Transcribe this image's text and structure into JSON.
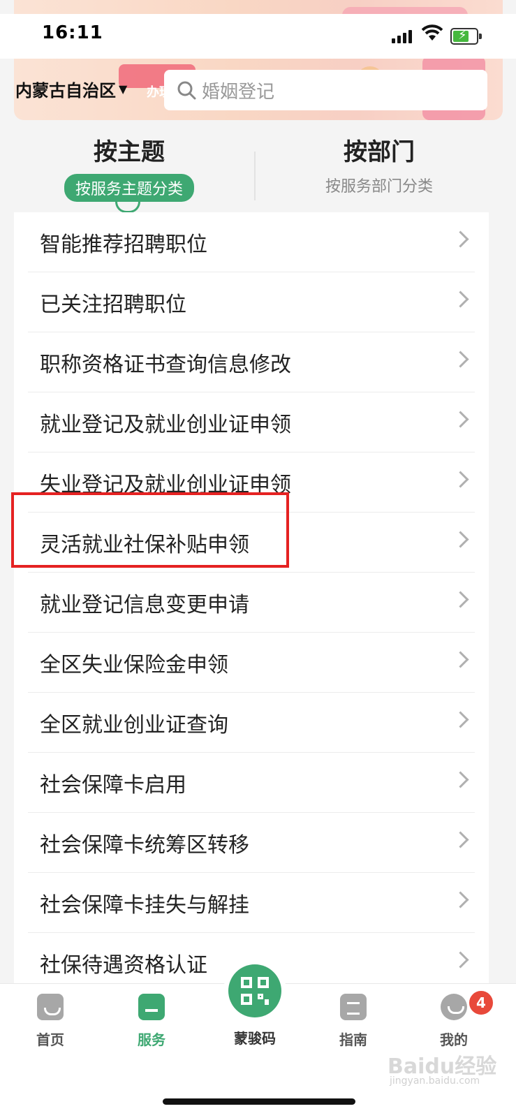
{
  "status_bar": {
    "time": "16:11"
  },
  "header": {
    "region": "内蒙古自治区",
    "banner_text": "办理",
    "search_placeholder": "婚姻登记"
  },
  "tabs": [
    {
      "title": "按主题",
      "subtitle": "按服务主题分类",
      "active": true
    },
    {
      "title": "按部门",
      "subtitle": "按服务部门分类",
      "active": false
    }
  ],
  "services": [
    "智能推荐招聘职位",
    "已关注招聘职位",
    "职称资格证书查询信息修改",
    "就业登记及就业创业证申领",
    "失业登记及就业创业证申领",
    "灵活就业社保补贴申领",
    "就业登记信息变更申请",
    "全区失业保险金申领",
    "全区就业创业证查询",
    "社会保障卡启用",
    "社会保障卡统筹区转移",
    "社会保障卡挂失与解挂",
    "社保待遇资格认证"
  ],
  "highlighted_item": "灵活就业社保补贴申领",
  "bottom_nav": {
    "home": "首页",
    "service": "服务",
    "code": "蒙骏码",
    "guide": "指南",
    "mine": "我的",
    "mine_badge": "4"
  },
  "watermark": {
    "brand": "Baidu经验",
    "url": "jingyan.baidu.com"
  },
  "colors": {
    "accent": "#3ea872",
    "highlight_box": "#e52222",
    "badge": "#e8493a"
  }
}
